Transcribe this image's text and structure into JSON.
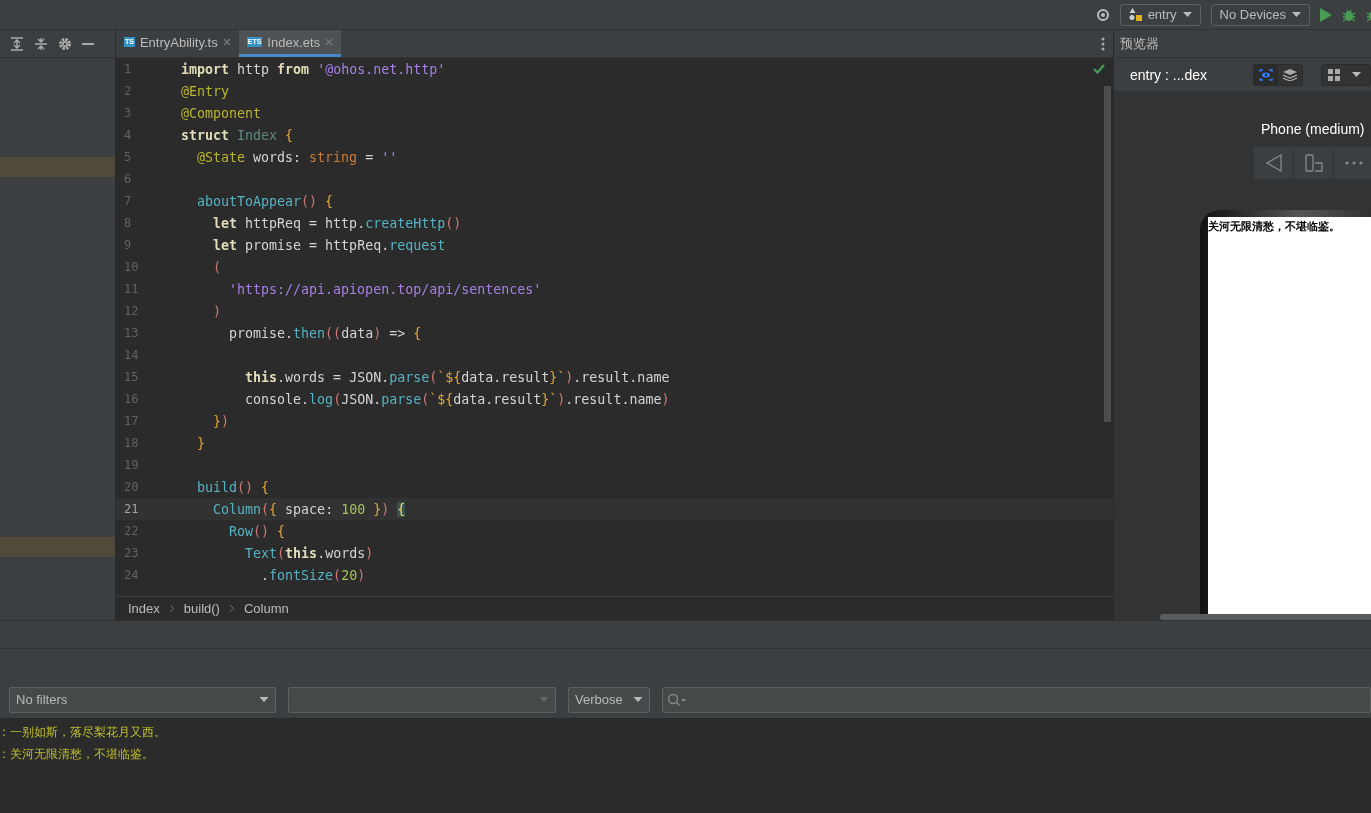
{
  "toolbar": {
    "module": "entry",
    "device": "No Devices"
  },
  "tabs": [
    {
      "label": "EntryAbility.ts",
      "badge": "TS",
      "selected": false
    },
    {
      "label": "Index.ets",
      "badge": "ETS",
      "selected": true
    }
  ],
  "editor": {
    "lines": [
      {
        "number": "1",
        "current": false,
        "tokens": [
          {
            "text": "import",
            "kind": "kw"
          },
          {
            "text": " http ",
            "kind": "plain"
          },
          {
            "text": "from",
            "kind": "kw"
          },
          {
            "text": " '@ohos.net.http'",
            "kind": "str"
          }
        ]
      },
      {
        "number": "2",
        "current": false,
        "tokens": [
          {
            "text": "@Entry",
            "kind": "deco"
          }
        ]
      },
      {
        "number": "3",
        "current": false,
        "tokens": [
          {
            "text": "@Component",
            "kind": "deco"
          }
        ]
      },
      {
        "number": "4",
        "current": false,
        "tokens": [
          {
            "text": "struct",
            "kind": "kw"
          },
          {
            "text": " Index",
            "kind": "cls"
          },
          {
            "text": " {",
            "kind": "brace"
          }
        ]
      },
      {
        "number": "5",
        "current": false,
        "tokens": [
          {
            "text": "  @State",
            "kind": "deco"
          },
          {
            "text": " words: ",
            "kind": "plain"
          },
          {
            "text": "string",
            "kind": "type"
          },
          {
            "text": " = ",
            "kind": "plain"
          },
          {
            "text": "''",
            "kind": "str"
          }
        ]
      },
      {
        "number": "6",
        "current": false
      },
      {
        "number": "7",
        "current": false,
        "tokens": [
          {
            "text": "  aboutToAppear",
            "kind": "fn"
          },
          {
            "text": "()",
            "kind": "paren"
          },
          {
            "text": " {",
            "kind": "brace"
          }
        ]
      },
      {
        "number": "8",
        "current": false,
        "tokens": [
          {
            "text": "    let",
            "kind": "kw"
          },
          {
            "text": " httpReq = http.",
            "kind": "plain"
          },
          {
            "text": "createHttp",
            "kind": "fn"
          },
          {
            "text": "()",
            "kind": "paren"
          }
        ]
      },
      {
        "number": "9",
        "current": false,
        "tokens": [
          {
            "text": "    let",
            "kind": "kw"
          },
          {
            "text": " promise = httpReq.",
            "kind": "plain"
          },
          {
            "text": "request",
            "kind": "fn"
          }
        ]
      },
      {
        "number": "10",
        "current": false,
        "tokens": [
          {
            "text": "    (",
            "kind": "paren"
          }
        ]
      },
      {
        "number": "11",
        "current": false,
        "tokens": [
          {
            "text": "      'https://api.apiopen.top/api/sentences'",
            "kind": "str"
          }
        ]
      },
      {
        "number": "12",
        "current": false,
        "tokens": [
          {
            "text": "    )",
            "kind": "paren"
          }
        ]
      },
      {
        "number": "13",
        "current": false,
        "tokens": [
          {
            "text": "      promise.",
            "kind": "plain"
          },
          {
            "text": "then",
            "kind": "fn"
          },
          {
            "text": "((",
            "kind": "paren"
          },
          {
            "text": "data",
            "kind": "plain"
          },
          {
            "text": ")",
            "kind": "paren"
          },
          {
            "text": " => ",
            "kind": "plain"
          },
          {
            "text": "{",
            "kind": "brace"
          }
        ]
      },
      {
        "number": "14",
        "current": false
      },
      {
        "number": "15",
        "current": false,
        "tokens": [
          {
            "text": "        this",
            "kind": "kw"
          },
          {
            "text": ".words = JSON.",
            "kind": "plain"
          },
          {
            "text": "parse",
            "kind": "fn"
          },
          {
            "text": "(",
            "kind": "paren"
          },
          {
            "text": "`${",
            "kind": "brace"
          },
          {
            "text": "data.result",
            "kind": "plain"
          },
          {
            "text": "}`",
            "kind": "brace"
          },
          {
            "text": ")",
            "kind": "paren"
          },
          {
            "text": ".result.name",
            "kind": "plain"
          }
        ]
      },
      {
        "number": "16",
        "current": false,
        "tokens": [
          {
            "text": "        console.",
            "kind": "plain"
          },
          {
            "text": "log",
            "kind": "fn"
          },
          {
            "text": "(",
            "kind": "paren"
          },
          {
            "text": "JSON.",
            "kind": "plain"
          },
          {
            "text": "parse",
            "kind": "fn"
          },
          {
            "text": "(",
            "kind": "paren"
          },
          {
            "text": "`${",
            "kind": "brace"
          },
          {
            "text": "data.result",
            "kind": "plain"
          },
          {
            "text": "}`",
            "kind": "brace"
          },
          {
            "text": ")",
            "kind": "paren"
          },
          {
            "text": ".result.name",
            "kind": "plain"
          },
          {
            "text": ")",
            "kind": "paren"
          }
        ]
      },
      {
        "number": "17",
        "current": false,
        "tokens": [
          {
            "text": "    }",
            "kind": "brace"
          },
          {
            "text": ")",
            "kind": "paren"
          }
        ]
      },
      {
        "number": "18",
        "current": false,
        "tokens": [
          {
            "text": "  }",
            "kind": "brace"
          }
        ]
      },
      {
        "number": "19",
        "current": false
      },
      {
        "number": "20",
        "current": false,
        "tokens": [
          {
            "text": "  build",
            "kind": "fn"
          },
          {
            "text": "()",
            "kind": "paren"
          },
          {
            "text": " {",
            "kind": "brace"
          }
        ]
      },
      {
        "number": "21",
        "current": true,
        "tokens": [
          {
            "text": "    Column",
            "kind": "fn"
          },
          {
            "text": "(",
            "kind": "paren"
          },
          {
            "text": "{",
            "kind": "brace"
          },
          {
            "text": " space: ",
            "kind": "plain"
          },
          {
            "text": "100",
            "kind": "num"
          },
          {
            "text": " }",
            "kind": "brace"
          },
          {
            "text": ") ",
            "kind": "paren"
          },
          {
            "text": "{",
            "kind": "match"
          }
        ]
      },
      {
        "number": "22",
        "current": false,
        "tokens": [
          {
            "text": "      Row",
            "kind": "fn"
          },
          {
            "text": "()",
            "kind": "paren"
          },
          {
            "text": " {",
            "kind": "brace"
          }
        ]
      },
      {
        "number": "23",
        "current": false,
        "tokens": [
          {
            "text": "        Text",
            "kind": "fn"
          },
          {
            "text": "(",
            "kind": "paren"
          },
          {
            "text": "this",
            "kind": "kw"
          },
          {
            "text": ".words",
            "kind": "plain"
          },
          {
            "text": ")",
            "kind": "paren"
          }
        ]
      },
      {
        "number": "24",
        "current": false,
        "tokens": [
          {
            "text": "          .",
            "kind": "plain"
          },
          {
            "text": "fontSize",
            "kind": "fn"
          },
          {
            "text": "(",
            "kind": "paren"
          },
          {
            "text": "20",
            "kind": "num"
          },
          {
            "text": ")",
            "kind": "paren"
          }
        ]
      }
    ]
  },
  "breadcrumbs": [
    "Index",
    "build()",
    "Column"
  ],
  "preview": {
    "title": "预览器",
    "target": "entry : ...dex",
    "views": [
      {
        "kind": "eye",
        "selected": true
      },
      {
        "kind": "layers",
        "selected": false
      }
    ],
    "device": "Phone (medium)",
    "screen_text": "关河无限清愁，不堪临鉴。"
  },
  "log": {
    "filter": "No filters",
    "level": "Verbose",
    "entries": [
      ": 一别如斯，落尽梨花月又西。",
      ": 关河无限清愁，不堪临鉴。"
    ]
  }
}
